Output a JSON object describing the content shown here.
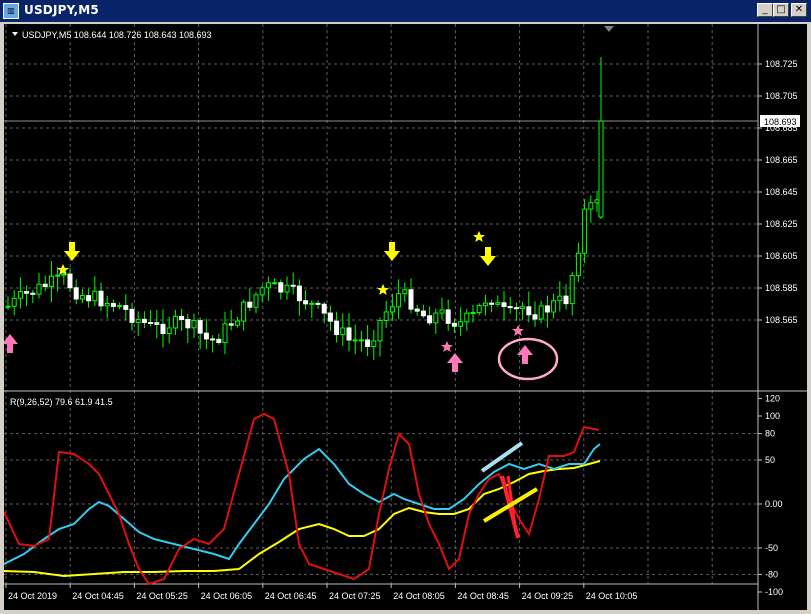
{
  "window": {
    "title": "USDJPY,M5",
    "icon": "chart-window-icon",
    "buttons": [
      {
        "name": "minimize",
        "glyph": "_"
      },
      {
        "name": "maximize",
        "glyph": "□"
      },
      {
        "name": "close",
        "glyph": "✕"
      }
    ]
  },
  "main_pane": {
    "header": "USDJPY,M5  108.644 108.726 108.643 108.693",
    "y_ticks": [
      "108.725",
      "108.705",
      "108.685",
      "108.665",
      "108.645",
      "108.625",
      "108.605",
      "108.585",
      "108.565"
    ],
    "current_price": "108.693",
    "colors": {
      "bull": "#00ff00",
      "bear": "#ffffff",
      "grid": "#606060",
      "arrow_yellow": "#ffff00",
      "arrow_pink": "#ff77bb"
    }
  },
  "indicator_pane": {
    "header": "R(9,26,52) 79.6 61.9 41.5",
    "y_ticks": [
      "120",
      "100",
      "80",
      "50",
      "0.00",
      "-50",
      "-80",
      "-100"
    ],
    "colors": {
      "fast": "#e01010",
      "mid": "#33ccee",
      "slow": "#ffff00"
    }
  },
  "time_axis": [
    "24 Oct 2019",
    "24 Oct 04:45",
    "24 Oct 05:25",
    "24 Oct 06:05",
    "24 Oct 06:45",
    "24 Oct 07:25",
    "24 Oct 08:05",
    "24 Oct 08:45",
    "24 Oct 09:25",
    "24 Oct 10:05"
  ]
}
